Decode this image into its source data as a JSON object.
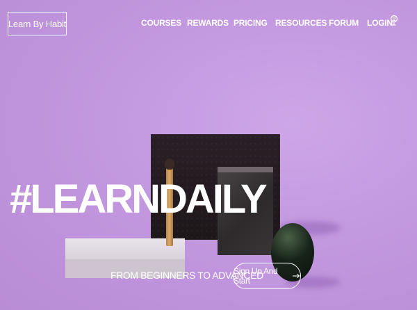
{
  "brand": {
    "logo_text": "Learn By Habit"
  },
  "nav": {
    "items": [
      {
        "label": "COURSES"
      },
      {
        "label": "REWARDS"
      },
      {
        "label": "PRICING"
      },
      {
        "label": "RESOURCES"
      },
      {
        "label": "FORUM"
      },
      {
        "label": "LOGIN"
      }
    ],
    "login_icon": "user-icon"
  },
  "hero": {
    "headline": "#LEARNDAILY",
    "subheadline": "FROM BEGINNERS TO ADVANCED",
    "cta_label": "Sign Up And Start",
    "cta_icon": "arrow-right-icon"
  },
  "colors": {
    "background": "#c49ae0",
    "text": "#ffffff"
  }
}
